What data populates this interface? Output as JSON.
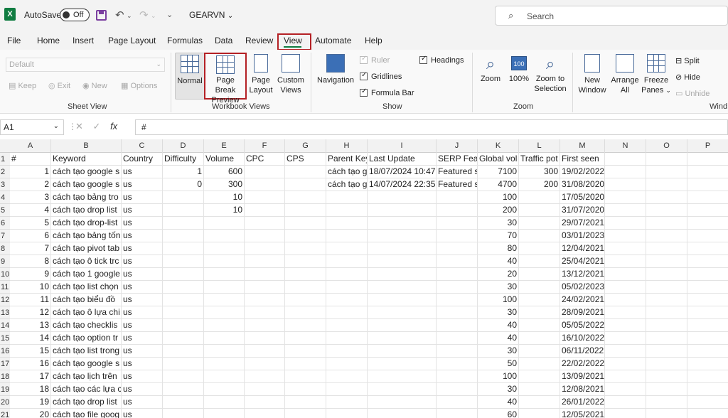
{
  "titlebar": {
    "app_logo": "X",
    "autosave_label": "AutoSave",
    "autosave_state": "Off",
    "doc_title": "GEARVN",
    "search_placeholder": "Search"
  },
  "tabs": [
    "File",
    "Home",
    "Insert",
    "Page Layout",
    "Formulas",
    "Data",
    "Review",
    "View",
    "Automate",
    "Help"
  ],
  "active_tab": "View",
  "ribbon": {
    "sheet_view": {
      "dropdown": "Default",
      "keep": "Keep",
      "exit": "Exit",
      "new": "New",
      "options": "Options",
      "label": "Sheet View"
    },
    "workbook_views": {
      "normal": "Normal",
      "page_break_1": "Page Break",
      "page_break_2": "Preview",
      "page_layout_1": "Page",
      "page_layout_2": "Layout",
      "custom_1": "Custom",
      "custom_2": "Views",
      "label": "Workbook Views"
    },
    "show": {
      "navigation": "Navigation",
      "ruler": "Ruler",
      "gridlines": "Gridlines",
      "formula_bar": "Formula Bar",
      "headings": "Headings",
      "label": "Show"
    },
    "zoom": {
      "zoom": "Zoom",
      "hundred": "100%",
      "zoom_sel_1": "Zoom to",
      "zoom_sel_2": "Selection",
      "label": "Zoom"
    },
    "window": {
      "new_1": "New",
      "new_2": "Window",
      "arrange_1": "Arrange",
      "arrange_2": "All",
      "freeze_1": "Freeze",
      "freeze_2": "Panes",
      "split": "Split",
      "hide": "Hide",
      "unhide": "Unhide",
      "label": "Wind"
    }
  },
  "formula_bar": {
    "name_box": "A1",
    "fx": "fx",
    "content": "#"
  },
  "columns": [
    "A",
    "B",
    "C",
    "D",
    "E",
    "F",
    "G",
    "H",
    "I",
    "J",
    "K",
    "L",
    "M",
    "N",
    "O",
    "P"
  ],
  "header_row": [
    "#",
    "Keyword",
    "Country",
    "Difficulty",
    "Volume",
    "CPC",
    "CPS",
    "Parent Key",
    "Last Update",
    "SERP Featu",
    "Global vol",
    "Traffic pot",
    "First seen",
    "",
    "",
    ""
  ],
  "rows": [
    [
      "1",
      "cách tạo google s",
      "us",
      "1",
      "600",
      "",
      "",
      "cách tạo g",
      "18/07/2024 10:47",
      "Featured s",
      "7100",
      "300",
      "19/02/2022"
    ],
    [
      "2",
      "cách tạo google s",
      "us",
      "0",
      "300",
      "",
      "",
      "cách tạo g",
      "14/07/2024 22:35",
      "Featured s",
      "4700",
      "200",
      "31/08/2020"
    ],
    [
      "3",
      "cách tạo bảng tro",
      "us",
      "",
      "10",
      "",
      "",
      "",
      "",
      "",
      "100",
      "",
      "17/05/2020"
    ],
    [
      "4",
      "cách tạo drop list",
      "us",
      "",
      "10",
      "",
      "",
      "",
      "",
      "",
      "200",
      "",
      "31/07/2020"
    ],
    [
      "5",
      "cách tạo drop-list",
      "us",
      "",
      "",
      "",
      "",
      "",
      "",
      "",
      "30",
      "",
      "29/07/2021"
    ],
    [
      "6",
      "cách tạo bảng tốn",
      "us",
      "",
      "",
      "",
      "",
      "",
      "",
      "",
      "70",
      "",
      "03/01/2023"
    ],
    [
      "7",
      "cách tạo pivot tab",
      "us",
      "",
      "",
      "",
      "",
      "",
      "",
      "",
      "80",
      "",
      "12/04/2021"
    ],
    [
      "8",
      "cách tạo ô tick trc",
      "us",
      "",
      "",
      "",
      "",
      "",
      "",
      "",
      "40",
      "",
      "25/04/2021"
    ],
    [
      "9",
      "cách tạo 1 google",
      "us",
      "",
      "",
      "",
      "",
      "",
      "",
      "",
      "20",
      "",
      "13/12/2021"
    ],
    [
      "10",
      "cách tạo list chọn",
      "us",
      "",
      "",
      "",
      "",
      "",
      "",
      "",
      "30",
      "",
      "05/02/2023"
    ],
    [
      "11",
      "cách tạo biểu đồ",
      "us",
      "",
      "",
      "",
      "",
      "",
      "",
      "",
      "100",
      "",
      "24/02/2021"
    ],
    [
      "12",
      "cách tạo ô lựa chi",
      "us",
      "",
      "",
      "",
      "",
      "",
      "",
      "",
      "30",
      "",
      "28/09/2021"
    ],
    [
      "13",
      "cách tạo checklis",
      "us",
      "",
      "",
      "",
      "",
      "",
      "",
      "",
      "40",
      "",
      "05/05/2022"
    ],
    [
      "14",
      "cách tạo option tr",
      "us",
      "",
      "",
      "",
      "",
      "",
      "",
      "",
      "40",
      "",
      "16/10/2022"
    ],
    [
      "15",
      "cách tạo list trong",
      "us",
      "",
      "",
      "",
      "",
      "",
      "",
      "",
      "30",
      "",
      "06/11/2022"
    ],
    [
      "16",
      "cách tạo google s",
      "us",
      "",
      "",
      "",
      "",
      "",
      "",
      "",
      "50",
      "",
      "22/02/2022"
    ],
    [
      "17",
      "cách tạo lịch trên",
      "us",
      "",
      "",
      "",
      "",
      "",
      "",
      "",
      "100",
      "",
      "13/09/2021"
    ],
    [
      "18",
      "cách tạo các lựa c",
      "us",
      "",
      "",
      "",
      "",
      "",
      "",
      "",
      "30",
      "",
      "12/08/2021"
    ],
    [
      "19",
      "cách tạo drop list",
      "us",
      "",
      "",
      "",
      "",
      "",
      "",
      "",
      "40",
      "",
      "26/01/2022"
    ],
    [
      "20",
      "cách tạo file goog",
      "us",
      "",
      "",
      "",
      "",
      "",
      "",
      "",
      "60",
      "",
      "12/05/2021"
    ]
  ],
  "row_numbers": [
    "1",
    "2",
    "3",
    "4",
    "5",
    "6",
    "7",
    "8",
    "9",
    "10",
    "11",
    "12",
    "13",
    "14",
    "15",
    "16",
    "17",
    "18",
    "19",
    "20",
    "21"
  ]
}
